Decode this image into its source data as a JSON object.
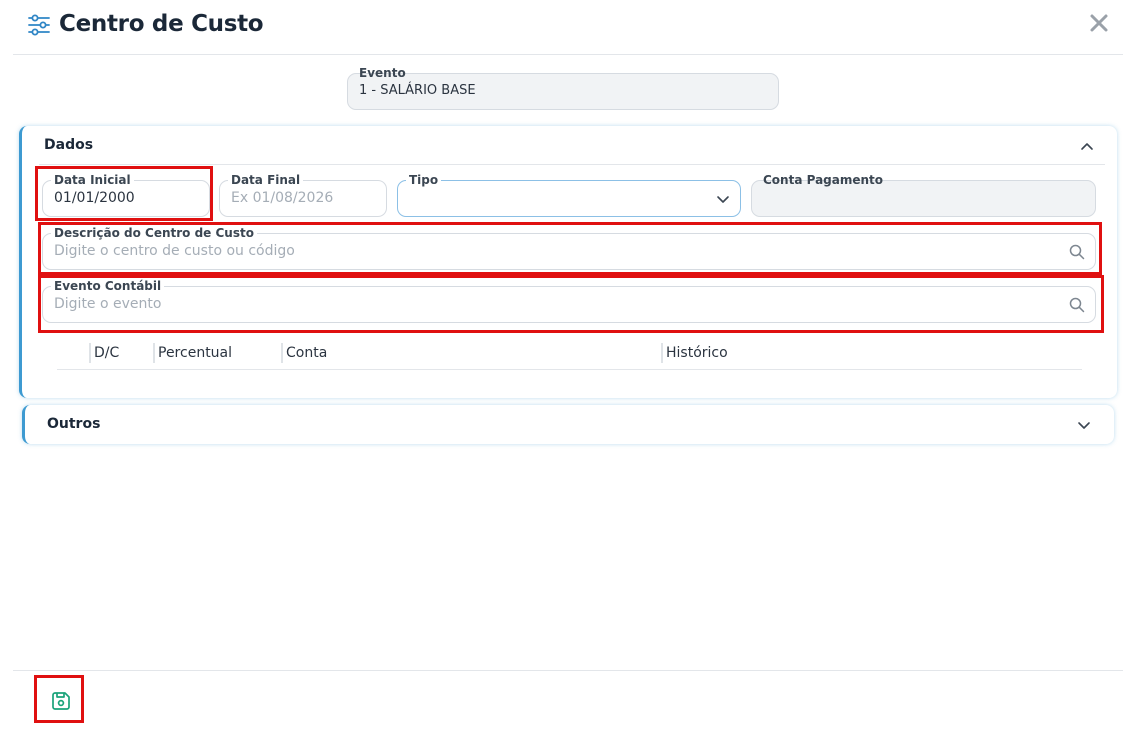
{
  "header": {
    "title": "Centro de Custo",
    "icon": "sliders-icon",
    "close_icon": "close-icon"
  },
  "evento": {
    "label": "Evento",
    "value": "1 - SALÁRIO BASE"
  },
  "dados": {
    "title": "Dados",
    "data_inicial": {
      "label": "Data Inicial",
      "value": "01/01/2000"
    },
    "data_final": {
      "label": "Data Final",
      "placeholder": "Ex 01/08/2026"
    },
    "tipo": {
      "label": "Tipo",
      "value": ""
    },
    "conta_pagamento": {
      "label": "Conta Pagamento",
      "value": ""
    },
    "descricao": {
      "label": "Descrição do Centro de Custo",
      "placeholder": "Digite o centro de custo ou código"
    },
    "evento_contabil": {
      "label": "Evento Contábil",
      "placeholder": "Digite o evento"
    },
    "table": {
      "columns": [
        "D/C",
        "Percentual",
        "Conta",
        "Histórico"
      ],
      "rows": []
    }
  },
  "outros": {
    "title": "Outros"
  },
  "footer": {
    "save_icon": "save-icon"
  },
  "colors": {
    "accent": "#3d9ad1",
    "highlight": "#e01010",
    "save": "#1aa37a"
  }
}
